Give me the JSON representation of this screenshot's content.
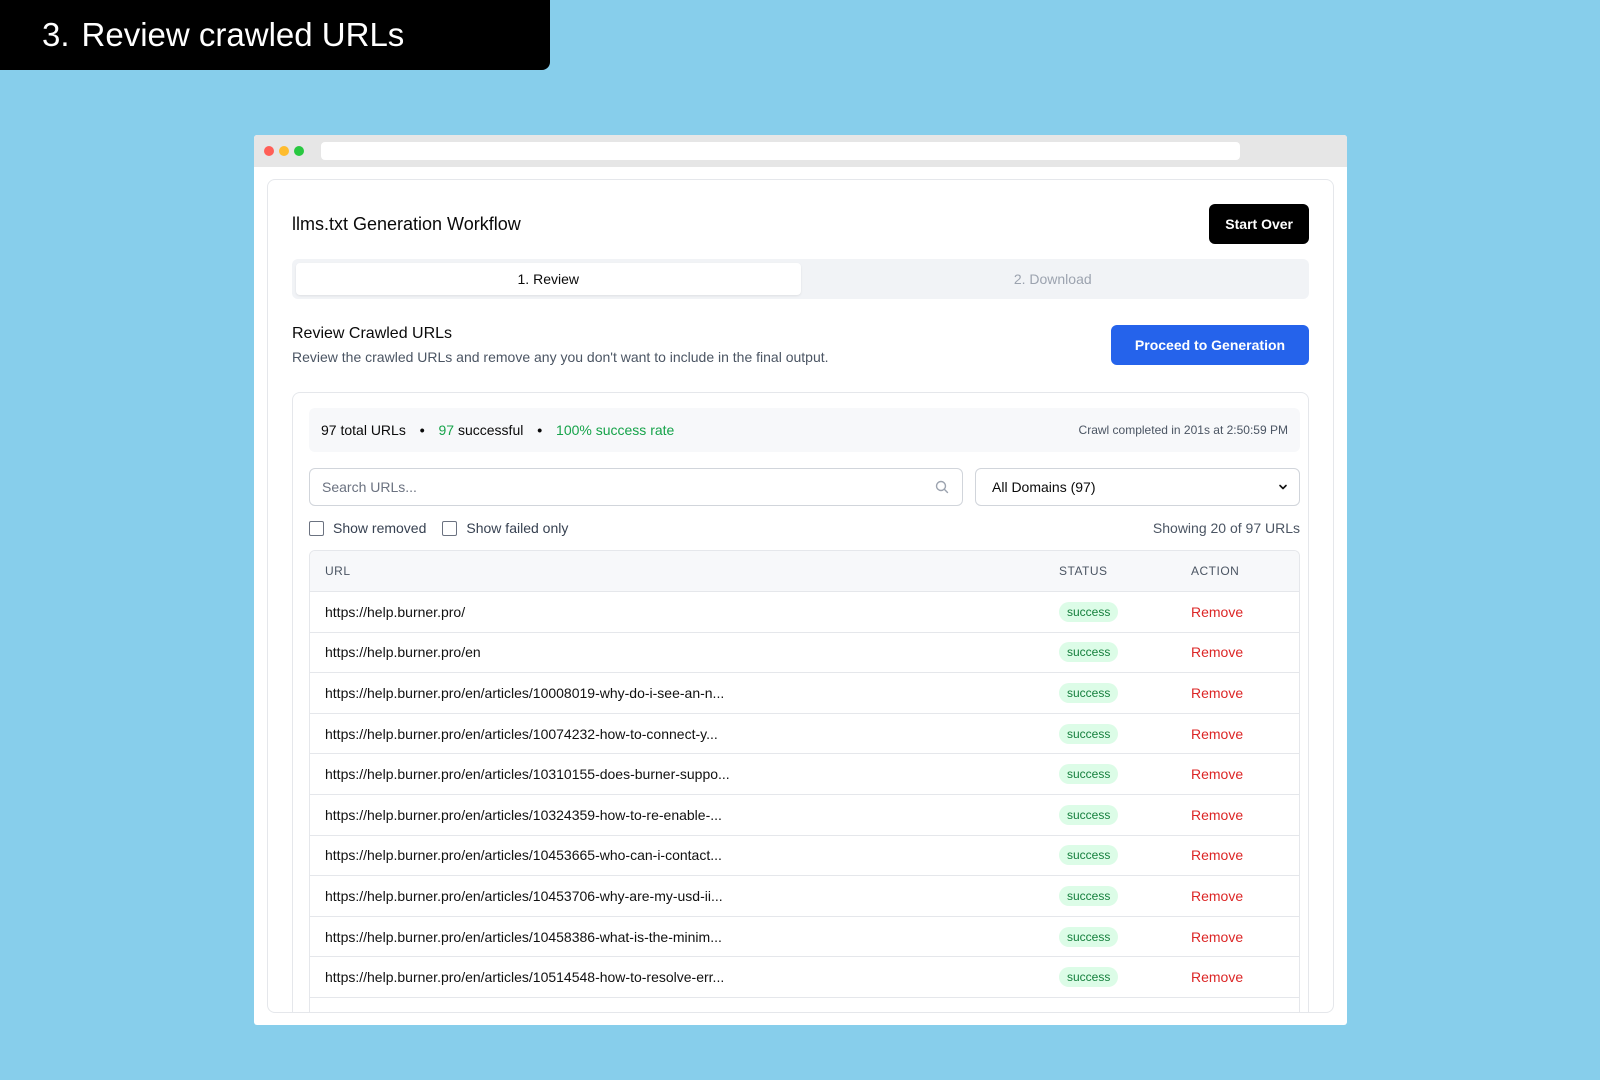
{
  "banner": {
    "number": "3.",
    "title": "Review crawled URLs"
  },
  "app": {
    "title": "llms.txt Generation Workflow",
    "start_over_label": "Start Over",
    "tabs": [
      {
        "label": "1. Review",
        "active": true
      },
      {
        "label": "2. Download",
        "active": false
      }
    ]
  },
  "review": {
    "title": "Review Crawled URLs",
    "description": "Review the crawled URLs and remove any you don't want to include in the final output.",
    "proceed_label": "Proceed to Generation"
  },
  "stats": {
    "total": "97 total URLs",
    "successful_count": "97",
    "successful_label": "successful",
    "success_rate": "100% success rate",
    "separator": "•",
    "completed": "Crawl completed in 201s at 2:50:59 PM"
  },
  "filters": {
    "search_placeholder": "Search URLs...",
    "domain_select": "All Domains (97)",
    "show_removed_label": "Show removed",
    "show_failed_label": "Show failed only",
    "showing": "Showing 20 of 97 URLs"
  },
  "table": {
    "headers": {
      "url": "URL",
      "status": "STATUS",
      "action": "ACTION"
    },
    "rows": [
      {
        "url": "https://help.burner.pro/",
        "status": "success",
        "action": "Remove"
      },
      {
        "url": "https://help.burner.pro/en",
        "status": "success",
        "action": "Remove"
      },
      {
        "url": "https://help.burner.pro/en/articles/10008019-why-do-i-see-an-n...",
        "status": "success",
        "action": "Remove"
      },
      {
        "url": "https://help.burner.pro/en/articles/10074232-how-to-connect-y...",
        "status": "success",
        "action": "Remove"
      },
      {
        "url": "https://help.burner.pro/en/articles/10310155-does-burner-suppo...",
        "status": "success",
        "action": "Remove"
      },
      {
        "url": "https://help.burner.pro/en/articles/10324359-how-to-re-enable-...",
        "status": "success",
        "action": "Remove"
      },
      {
        "url": "https://help.burner.pro/en/articles/10453665-who-can-i-contact...",
        "status": "success",
        "action": "Remove"
      },
      {
        "url": "https://help.burner.pro/en/articles/10453706-why-are-my-usd-ii...",
        "status": "success",
        "action": "Remove"
      },
      {
        "url": "https://help.burner.pro/en/articles/10458386-what-is-the-minim...",
        "status": "success",
        "action": "Remove"
      },
      {
        "url": "https://help.burner.pro/en/articles/10514548-how-to-resolve-err...",
        "status": "success",
        "action": "Remove"
      }
    ]
  },
  "colors": {
    "background": "#87CEEB",
    "primary": "#2563eb",
    "success": "#16a34a",
    "danger": "#dc2626"
  }
}
